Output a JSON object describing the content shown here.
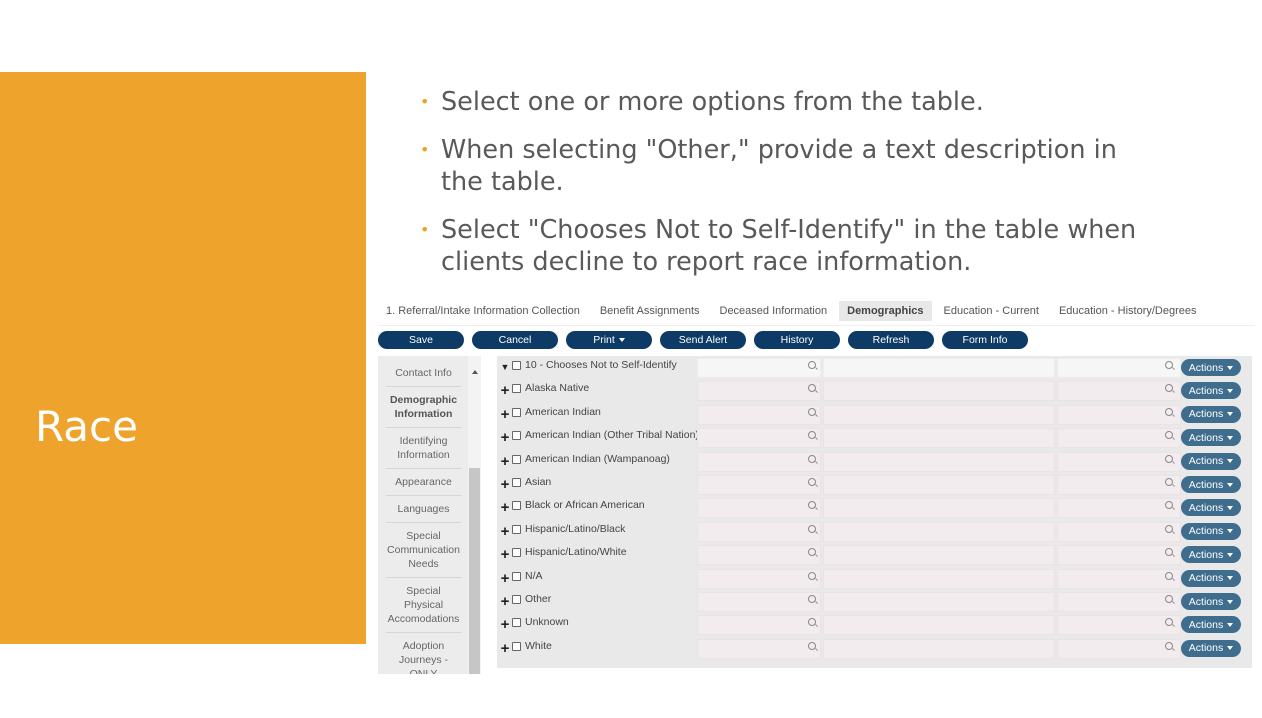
{
  "slide": {
    "title": "Race",
    "accent_color": "#EEA32D",
    "bullets": [
      "Select one or more options from the table.",
      "When selecting \"Other,\" provide a text description in the table.",
      "Select \"Chooses Not to Self-Identify\" in the table when clients decline to report race information."
    ]
  },
  "tabs": [
    {
      "label": "1. Referral/Intake Information Collection",
      "active": false
    },
    {
      "label": "Benefit Assignments",
      "active": false
    },
    {
      "label": "Deceased Information",
      "active": false
    },
    {
      "label": "Demographics",
      "active": true
    },
    {
      "label": "Education - Current",
      "active": false
    },
    {
      "label": "Education - History/Degrees",
      "active": false
    }
  ],
  "toolbar": {
    "button_color": "#0d3b66",
    "save": "Save",
    "cancel": "Cancel",
    "print": "Print",
    "send_alert": "Send Alert",
    "history": "History",
    "refresh": "Refresh",
    "form_info": "Form Info"
  },
  "sidenav": [
    {
      "label": "Contact Info",
      "active": false
    },
    {
      "label": "Demographic Information",
      "active": true
    },
    {
      "label": "Identifying Information",
      "active": false
    },
    {
      "label": "Appearance",
      "active": false
    },
    {
      "label": "Languages",
      "active": false
    },
    {
      "label": "Special Communication Needs",
      "active": false
    },
    {
      "label": "Special Physical Accomodations",
      "active": false
    },
    {
      "label": "Adoption Journeys - ONLY",
      "active": false
    }
  ],
  "race_rows": [
    {
      "label": "10 - Chooses Not to Self-Identify",
      "expanded": true
    },
    {
      "label": "Alaska Native",
      "expanded": false
    },
    {
      "label": "American Indian",
      "expanded": false
    },
    {
      "label": "American Indian (Other Tribal Nation)",
      "expanded": false
    },
    {
      "label": "American Indian (Wampanoag)",
      "expanded": false
    },
    {
      "label": "Asian",
      "expanded": false
    },
    {
      "label": "Black or African American",
      "expanded": false
    },
    {
      "label": "Hispanic/Latino/Black",
      "expanded": false
    },
    {
      "label": "Hispanic/Latino/White",
      "expanded": false
    },
    {
      "label": "N/A",
      "expanded": false
    },
    {
      "label": "Other",
      "expanded": false
    },
    {
      "label": "Unknown",
      "expanded": false
    },
    {
      "label": "White",
      "expanded": false
    }
  ],
  "row_actions_label": "Actions",
  "actions_color": "#3f6d8e"
}
